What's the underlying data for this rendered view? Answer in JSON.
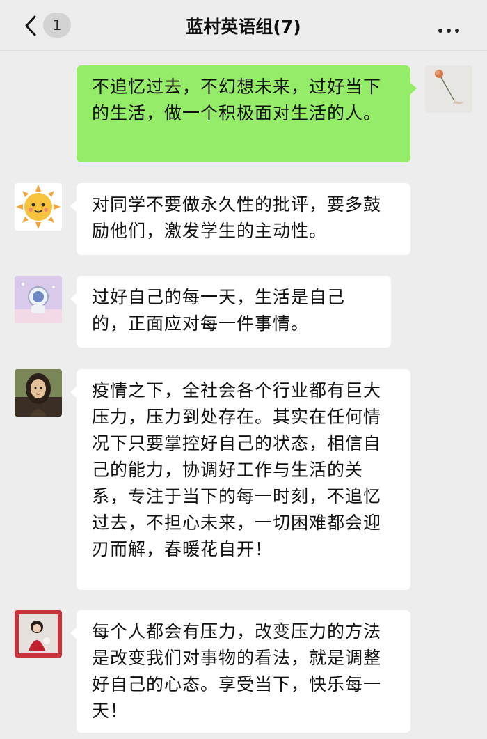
{
  "header": {
    "back_icon": "chevron-left-icon",
    "unread_count": "1",
    "title": "蓝村英语组(7)",
    "more_icon": "ellipsis-icon"
  },
  "messages": [
    {
      "side": "right",
      "avatar_icon": "rose-photo-avatar",
      "text": "不追忆过去，不幻想未来，过好当下的生活，做一个积极面对生活的人。"
    },
    {
      "side": "left",
      "avatar_icon": "sun-face-avatar",
      "text": "对同学不要做永久性的批评，要多鼓励他们，激发学生的主动性。"
    },
    {
      "side": "left",
      "avatar_icon": "cartoon-astronaut-avatar",
      "text": "过好自己的每一天，生活是自己的，正面应对每一件事情。"
    },
    {
      "side": "left",
      "avatar_icon": "mona-lisa-cartoon-avatar",
      "text": "疫情之下，全社会各个行业都有巨大压力，压力到处存在。其实在任何情况下只要掌控好自己的状态，相信自己的能力，协调好工作与生活的关系，专注于当下的每一时刻，不追忆过去，不担心未来，一切困难都会迎刃而解，春暖花自开！"
    },
    {
      "side": "left",
      "avatar_icon": "girl-in-red-photo-avatar",
      "text": "每个人都会有压力，改变压力的方法是改变我们对事物的看法，就是调整好自己的心态。享受当下，快乐每一天！"
    }
  ],
  "colors": {
    "background": "#ededed",
    "my_bubble": "#95ec69",
    "other_bubble": "#ffffff"
  }
}
